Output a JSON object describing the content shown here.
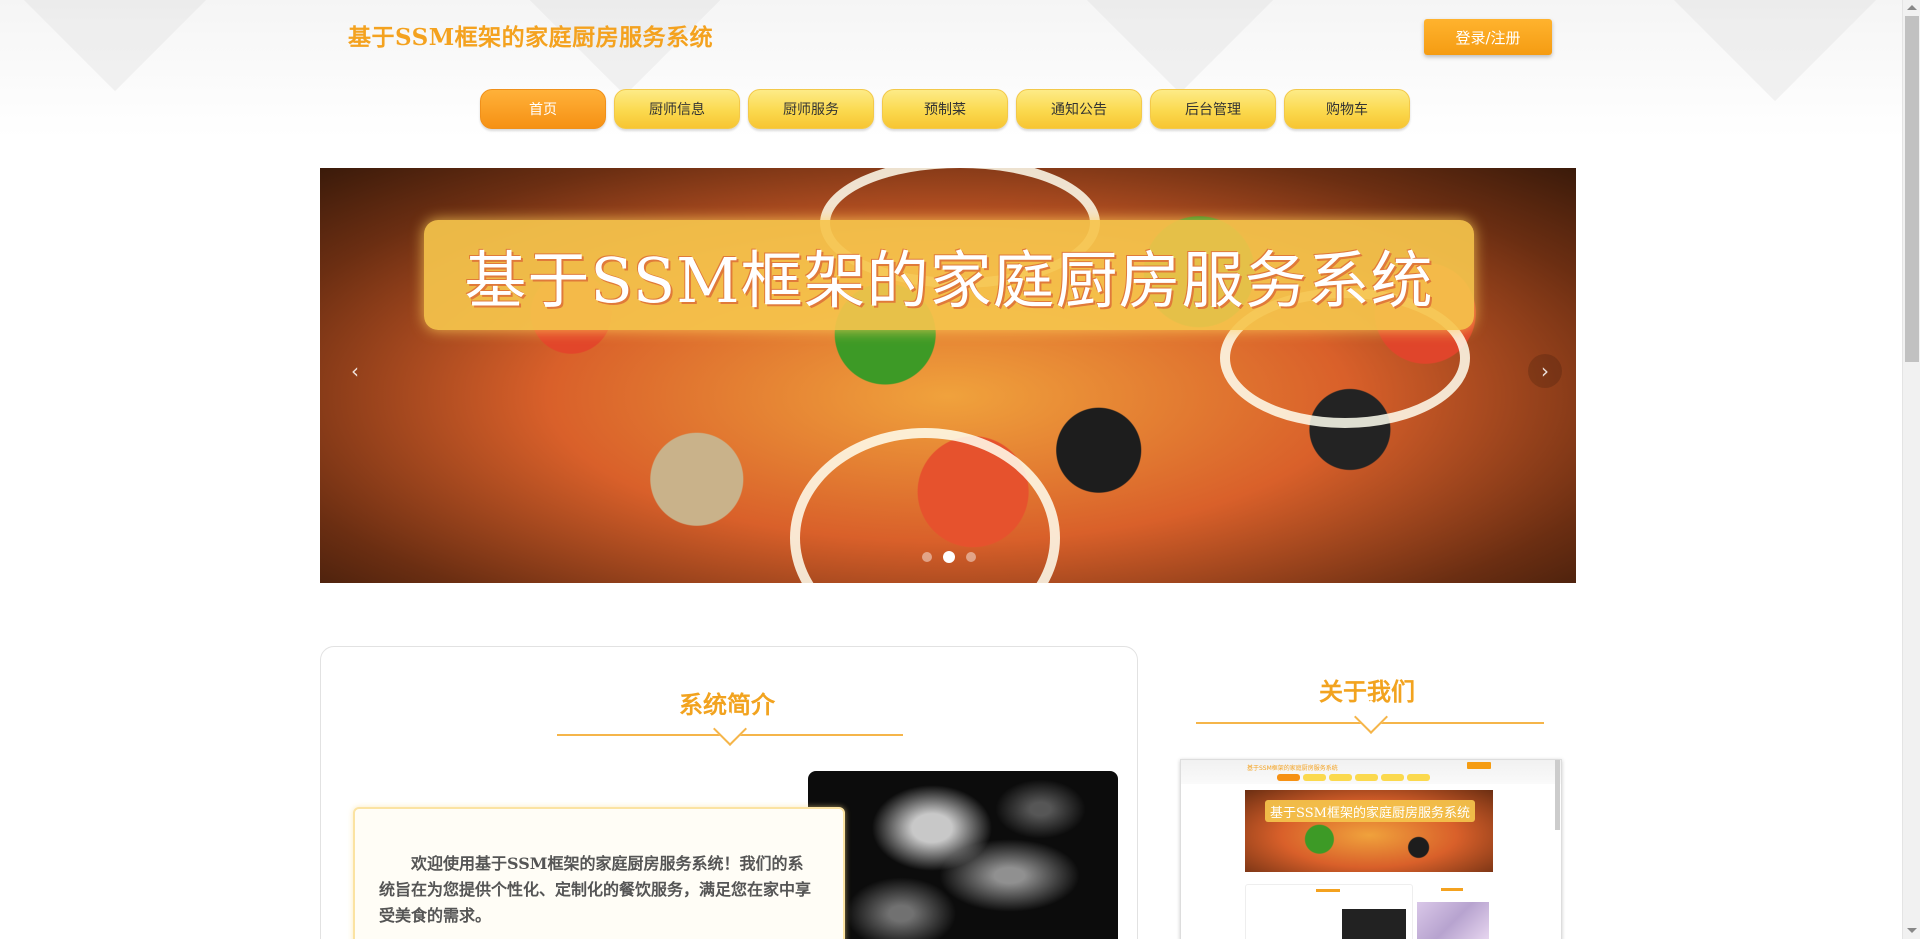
{
  "header": {
    "site_title": "基于SSM框架的家庭厨房服务系统",
    "login_label": "登录/注册"
  },
  "nav": {
    "items": [
      {
        "label": "首页",
        "active": true
      },
      {
        "label": "厨师信息",
        "active": false
      },
      {
        "label": "厨师服务",
        "active": false
      },
      {
        "label": "预制菜",
        "active": false
      },
      {
        "label": "通知公告",
        "active": false
      },
      {
        "label": "后台管理",
        "active": false
      },
      {
        "label": "购物车",
        "active": false
      }
    ]
  },
  "banner": {
    "caption": "基于SSM框架的家庭厨房服务系统",
    "prev_glyph": "‹",
    "next_glyph": "›",
    "slide_count": 3,
    "active_slide": 2
  },
  "intro": {
    "title": "系统简介",
    "text": "欢迎使用基于SSM框架的家庭厨房服务系统！我们的系统旨在为您提供个性化、定制化的餐饮服务，满足您在家中享受美食的需求。"
  },
  "about": {
    "title": "关于我们",
    "preview_caption": "基于SSM框架的家庭厨房服务系统"
  },
  "colors": {
    "accent": "#f4a21f",
    "nav_active": "#f69114",
    "nav_inactive": "#fbd94e"
  }
}
